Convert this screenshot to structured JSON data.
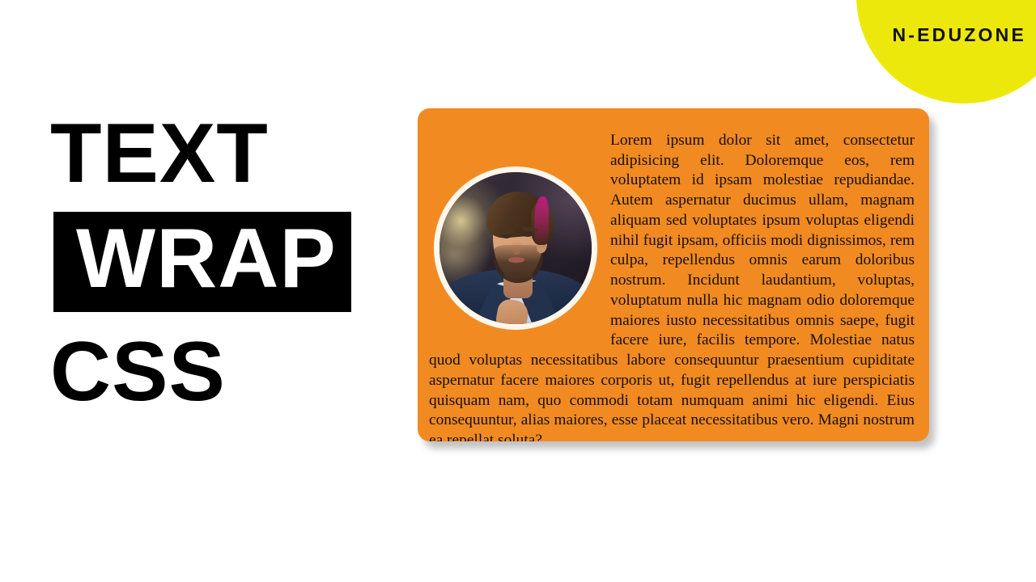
{
  "slide": {
    "background_color": "#ffffff"
  },
  "brand": {
    "name": "N-EDUZONE",
    "badge_color": "#EDE80C",
    "text_color": "#121212"
  },
  "headline": {
    "line1": "TEXT",
    "line2": "WRAP",
    "line3": "CSS",
    "highlight_background": "#000000",
    "highlight_text_color": "#ffffff",
    "text_color": "#000000"
  },
  "card": {
    "background_color": "#F28A22",
    "text_color": "#15100c",
    "avatar": {
      "alt": "portrait of a young bearded man in a navy suit adjusting his collar",
      "ring_color": "#FFF7EC"
    },
    "paragraph": "Lorem ipsum dolor sit amet, consectetur adipisicing elit. Doloremque eos, rem voluptatem id ipsam molestiae repudiandae. Autem aspernatur ducimus ullam, magnam aliquam sed voluptates ipsum voluptas eligendi nihil fugit ipsam, officiis modi dignissimos, rem culpa, repellendus omnis earum doloribus nostrum. Incidunt laudantium, voluptas, voluptatum nulla hic magnam odio doloremque maiores iusto necessitatibus omnis saepe, fugit facere iure, facilis tempore. Molestiae natus quod voluptas necessitatibus labore consequuntur praesentium cupiditate aspernatur facere maiores corporis ut, fugit repellendus at iure perspiciatis quisquam nam, quo commodi totam numquam animi hic eligendi. Eius consequuntur, alias maiores, esse placeat necessitatibus vero. Magni nostrum ea repellat soluta?"
  }
}
